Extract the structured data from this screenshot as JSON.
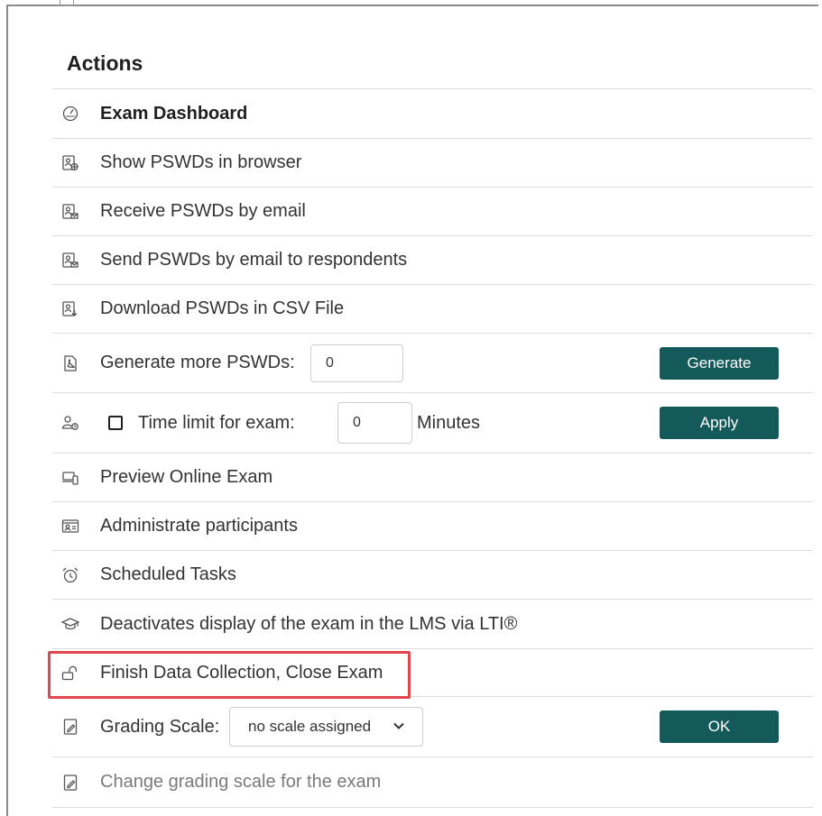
{
  "panel": {
    "title": "Actions"
  },
  "rows": [
    {
      "label": "Exam Dashboard",
      "icon": "speedometer-icon"
    },
    {
      "label": "Show PSWDs in browser",
      "icon": "user-globe-icon"
    },
    {
      "label": "Receive PSWDs by email",
      "icon": "user-mail-icon"
    },
    {
      "label": "Send PSWDs by email to respondents",
      "icon": "user-send-icon"
    },
    {
      "label": "Download PSWDs in CSV File",
      "icon": "user-download-icon"
    }
  ],
  "generate": {
    "label": "Generate more PSWDs:",
    "value": "0",
    "button": "Generate",
    "icon": "pdf-icon"
  },
  "timelimit": {
    "label": "Time limit for exam:",
    "value": "0",
    "unit": "Minutes",
    "button": "Apply",
    "checked": false,
    "icon": "user-clock-icon"
  },
  "rows2": [
    {
      "label": "Preview Online Exam",
      "icon": "monitor-phone-icon"
    },
    {
      "label": "Administrate participants",
      "icon": "id-card-icon"
    },
    {
      "label": "Scheduled Tasks",
      "icon": "alarm-clock-icon"
    },
    {
      "label": "Deactivates display of the exam in the LMS via LTI®",
      "icon": "graduation-cap-icon"
    },
    {
      "label": "Finish Data Collection, Close Exam",
      "icon": "unlock-icon"
    }
  ],
  "grading": {
    "label": "Grading Scale:",
    "selected": "no scale assigned",
    "button": "OK",
    "icon": "edit-document-icon"
  },
  "change_scale": {
    "label": "Change grading scale for the exam",
    "icon": "edit-document-icon"
  },
  "colors": {
    "button_bg": "#155a5a",
    "highlight": "#e0474c"
  }
}
